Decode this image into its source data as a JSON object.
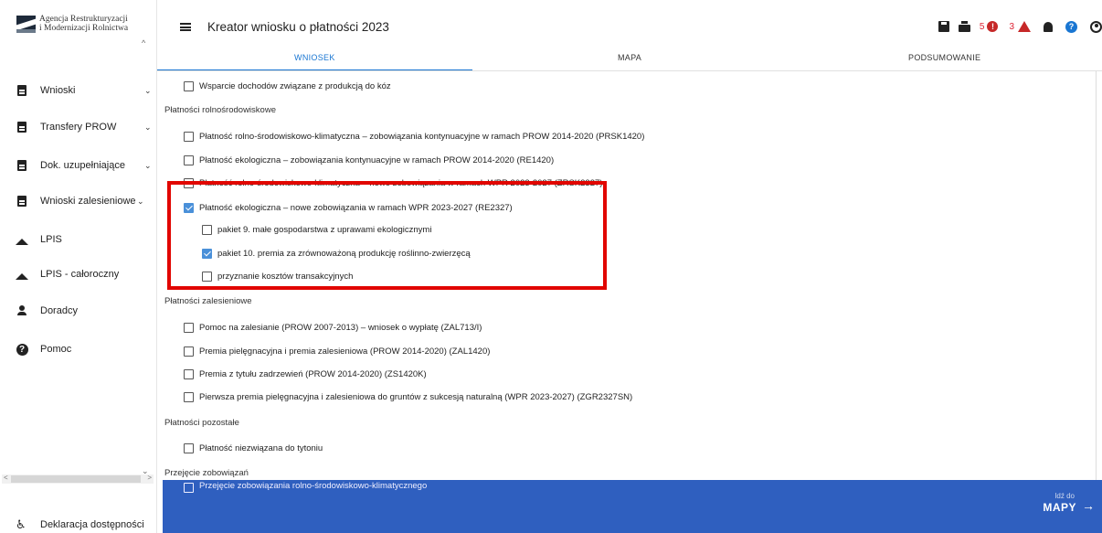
{
  "brand": {
    "line1": "Agencja Restrukturyzacji",
    "line2": "i Modernizacji Rolnictwa"
  },
  "sidebar": {
    "items": [
      {
        "label": "Wnioski",
        "chevron": "⌄",
        "icon": "document-icon"
      },
      {
        "label": "Transfery PROW",
        "chevron": "⌄",
        "icon": "document-icon"
      },
      {
        "label": "Dok. uzupełniające",
        "chevron": "⌄",
        "icon": "document-icon"
      },
      {
        "label": "Wnioski zalesieniowe",
        "chevron": "⌄",
        "icon": "document-icon"
      },
      {
        "label": "LPIS",
        "icon": "mountain-icon"
      },
      {
        "label": "LPIS - całoroczny",
        "icon": "mountain-icon"
      },
      {
        "label": "Doradcy",
        "icon": "person-icon"
      },
      {
        "label": "Pomoc",
        "icon": "help-icon"
      }
    ],
    "footer": {
      "label": "Deklaracja dostępności",
      "icon": "accessibility-icon"
    }
  },
  "header": {
    "title": "Kreator wniosku o płatności 2023",
    "error_count": "5",
    "warning_count": "3",
    "error_glyph": "!"
  },
  "tabs": [
    {
      "label": "WNIOSEK",
      "active": true
    },
    {
      "label": "MAPA",
      "active": false
    },
    {
      "label": "PODSUMOWANIE",
      "active": false
    }
  ],
  "content": {
    "goat_support": "Wsparcie dochodów związane z produkcją do kóz",
    "section_agri_env": "Płatności rolnośrodowiskowe",
    "prsk1420": "Płatność rolno-środowiskowo-klimatyczna – zobowiązania kontynuacyjne w ramach PROW 2014-2020 (PRSK1420)",
    "re1420": "Płatność ekologiczna – zobowiązania kontynuacyjne w ramach PROW 2014-2020 (RE1420)",
    "zrsk2327": "Płatność rolno-środowiskowo-klimatyczna – nowe zobowiązania w ramach WPR 2023-2027 (ZRSK2327)",
    "re2327": "Płatność ekologiczna – nowe zobowiązania w ramach WPR 2023-2027 (RE2327)",
    "pakiet9": "pakiet 9. małe gospodarstwa z uprawami ekologicznymi",
    "pakiet10": "pakiet 10. premia za zrównoważoną produkcję roślinno-zwierzęcą",
    "transaction_costs": "przyznanie kosztów transakcyjnych",
    "section_afforestation": "Płatności zalesieniowe",
    "zal713": "Pomoc na zalesianie (PROW 2007-2013) – wniosek o wypłatę (ZAL713/I)",
    "zal1420": "Premia pielęgnacyjna i premia zalesieniowa (PROW 2014-2020) (ZAL1420)",
    "zs1420k": "Premia z tytułu zadrzewień (PROW 2014-2020) (ZS1420K)",
    "zgr2327sn": "Pierwsza premia pielęgnacyjna i zalesieniowa do gruntów z sukcesją naturalną (WPR 2023-2027) (ZGR2327SN)",
    "section_other": "Płatności pozostałe",
    "tobacco": "Płatność niezwiązana do tytoniu",
    "section_takeover": "Przejęcie zobowiązań",
    "takeover_agri_env": "Przejęcie zobowiązania rolno-środowiskowo-klimatycznego"
  },
  "checked": {
    "re2327": true,
    "pakiet10": true
  },
  "footer_nav": {
    "small": "Idź do",
    "big": "MAPY",
    "arrow": "→"
  },
  "colors": {
    "accent": "#1976d2",
    "highlight": "#e10600",
    "bottom_bar": "#2f5fbf",
    "error": "#c62828"
  }
}
